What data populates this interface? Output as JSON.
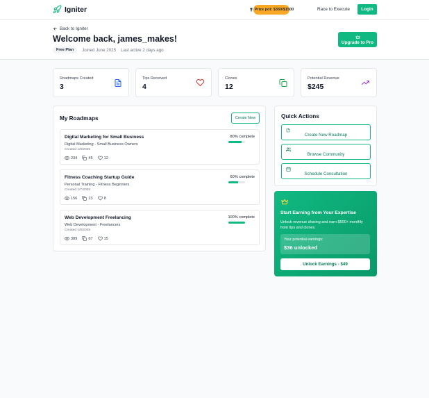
{
  "nav": {
    "brand": "Igniter",
    "prize_label": "Prize pot: $350/$1500",
    "race_link": "Race to Execute",
    "login_button": "Login"
  },
  "header": {
    "back_link": "Back to Igniter",
    "welcome": "Welcome back, james_makes!",
    "plan_badge": "Free Plan",
    "joined": "Joined June 2025",
    "last_active": "Last active 2 days ago",
    "upgrade_button": "Upgrade to Pro"
  },
  "stats": [
    {
      "label": "Roadmaps Created",
      "value": "3",
      "icon": "document-icon",
      "color": "#2563eb"
    },
    {
      "label": "Tips Received",
      "value": "4",
      "icon": "heart-icon",
      "color": "#dc2626"
    },
    {
      "label": "Clones",
      "value": "12",
      "icon": "copy-icon",
      "color": "#16a34a"
    },
    {
      "label": "Potential Revenue",
      "value": "$245",
      "icon": "trending-up-icon",
      "color": "#9333ea"
    }
  ],
  "roadmaps": {
    "title": "My Roadmaps",
    "create_button": "Create New",
    "items": [
      {
        "title": "Digital Marketing for Small Business",
        "subtitle": "Digital Marketing - Small Business Owners",
        "created": "Created 1/8/2025",
        "views": "234",
        "clones": "45",
        "likes": "12",
        "progress_label": "80% complete",
        "progress": 0.8
      },
      {
        "title": "Fitness Coaching Startup Guide",
        "subtitle": "Personal Training - Fitness Beginners",
        "created": "Created 1/7/2025",
        "views": "156",
        "clones": "23",
        "likes": "8",
        "progress_label": "60% complete",
        "progress": 0.6
      },
      {
        "title": "Web Development Freelancing",
        "subtitle": "Web Development - Freelancers",
        "created": "Created 1/6/2025",
        "views": "389",
        "clones": "67",
        "likes": "15",
        "progress_label": "100% complete",
        "progress": 1.0
      }
    ]
  },
  "quick_actions": {
    "title": "Quick Actions",
    "items": [
      {
        "label": "Create New Roadmap",
        "icon": "document-icon"
      },
      {
        "label": "Browse Community",
        "icon": "users-icon"
      },
      {
        "label": "Schedule Consultation",
        "icon": "calendar-icon"
      }
    ]
  },
  "earnings": {
    "title": "Start Earning from Your Expertise",
    "description": "Unlock revenue sharing and earn $500+ monthly from tips and clones.",
    "box_label": "Your potential earnings:",
    "box_value": "$36 unlocked",
    "unlock_button": "Unlock Earnings - $49"
  },
  "colors": {
    "accent": "#10b981",
    "prize": "#f9a825"
  }
}
